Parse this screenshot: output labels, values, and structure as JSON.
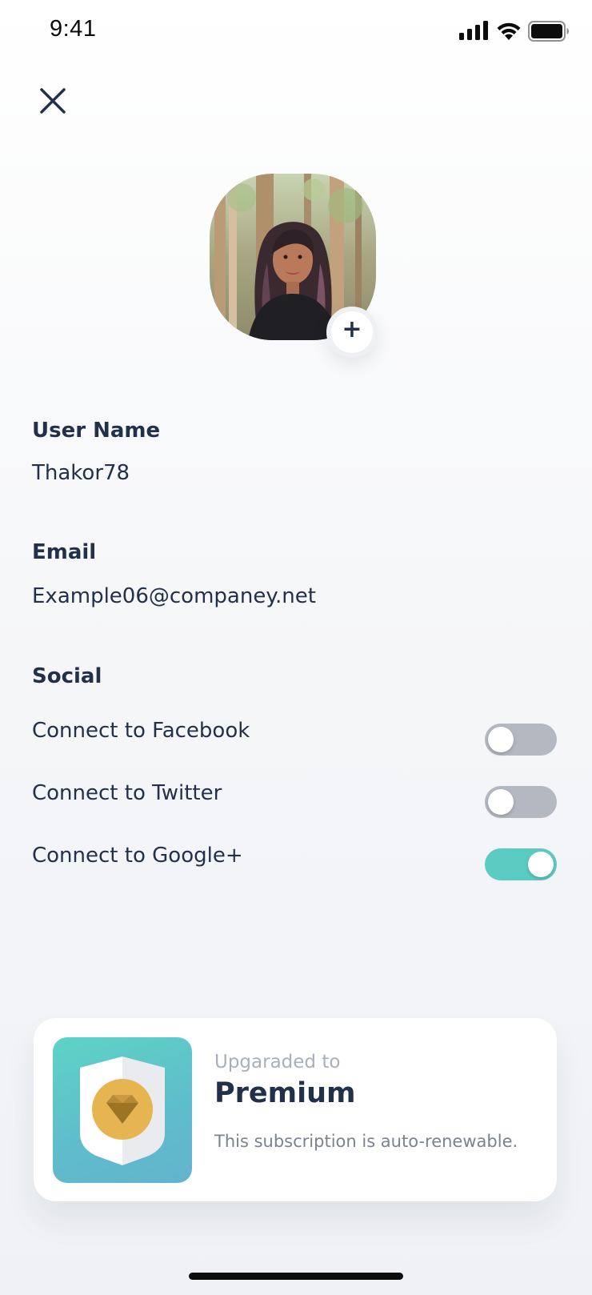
{
  "status_bar": {
    "time": "9:41",
    "icons": [
      "signal-icon",
      "wifi-icon",
      "battery-icon"
    ]
  },
  "header": {
    "close_icon": "close-icon"
  },
  "profile": {
    "avatar_icon": "avatar",
    "add_photo_symbol": "+"
  },
  "fields": {
    "username_label": "User Name",
    "username_value": "Thakor78",
    "email_label": "Email",
    "email_value": "Example06@companey.net"
  },
  "social": {
    "heading": "Social",
    "items": [
      {
        "label": "Connect to Facebook",
        "enabled": false
      },
      {
        "label": "Connect to Twitter",
        "enabled": false
      },
      {
        "label": "Connect to Google+",
        "enabled": true
      }
    ]
  },
  "premium": {
    "subtitle": "Upgaraded to",
    "title": "Premium",
    "description": "This subscription is auto-renewable.",
    "badge_icon": "diamond-shield-icon"
  },
  "colors": {
    "text_primary": "#22304a",
    "toggle_on": "#5bcbc1",
    "toggle_off": "#b3b8c1",
    "badge_gradient_start": "#5dd3c6",
    "badge_gradient_end": "#62b3cd",
    "diamond_gold": "#e6b552"
  }
}
